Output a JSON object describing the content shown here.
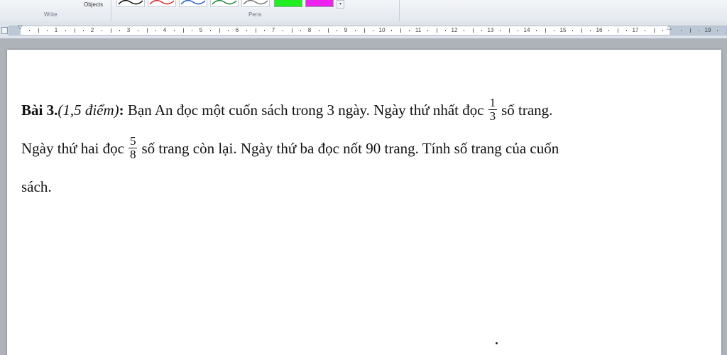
{
  "ribbon": {
    "objects_label": "Objects",
    "write_group_label": "Write",
    "pens_group_label": "Pens",
    "pens": [
      {
        "color": "#111111"
      },
      {
        "color": "#d62a2a"
      },
      {
        "color": "#2a5fc0"
      },
      {
        "color": "#1a8a3a"
      },
      {
        "color": "#777777"
      }
    ],
    "swatches": [
      {
        "color": "#22ee22"
      },
      {
        "color": "#ee22ee"
      }
    ],
    "more_icon": "chevron-down-icon"
  },
  "ruler": {
    "numbers": [
      "1",
      "2",
      "3",
      "4",
      "5",
      "6",
      "7",
      "8",
      "9",
      "10",
      "11",
      "12",
      "13",
      "14",
      "15",
      "16",
      "17",
      "19"
    ]
  },
  "document": {
    "line1": {
      "title": "Bài 3.",
      "points": "(1,5 điểm)",
      "colon": ":",
      "text_a": " Bạn An đọc một cuốn sách trong 3 ngày. Ngày thứ nhất đọc",
      "frac_num": "1",
      "frac_den": "3",
      "text_b": "số trang."
    },
    "line2": {
      "text_a": "Ngày thứ hai đọc",
      "frac_num": "5",
      "frac_den": "8",
      "text_b": "số trang còn lại. Ngày thứ ba đọc nốt 90 trang. Tính số trang của cuốn"
    },
    "line3": {
      "text": "sách."
    }
  }
}
